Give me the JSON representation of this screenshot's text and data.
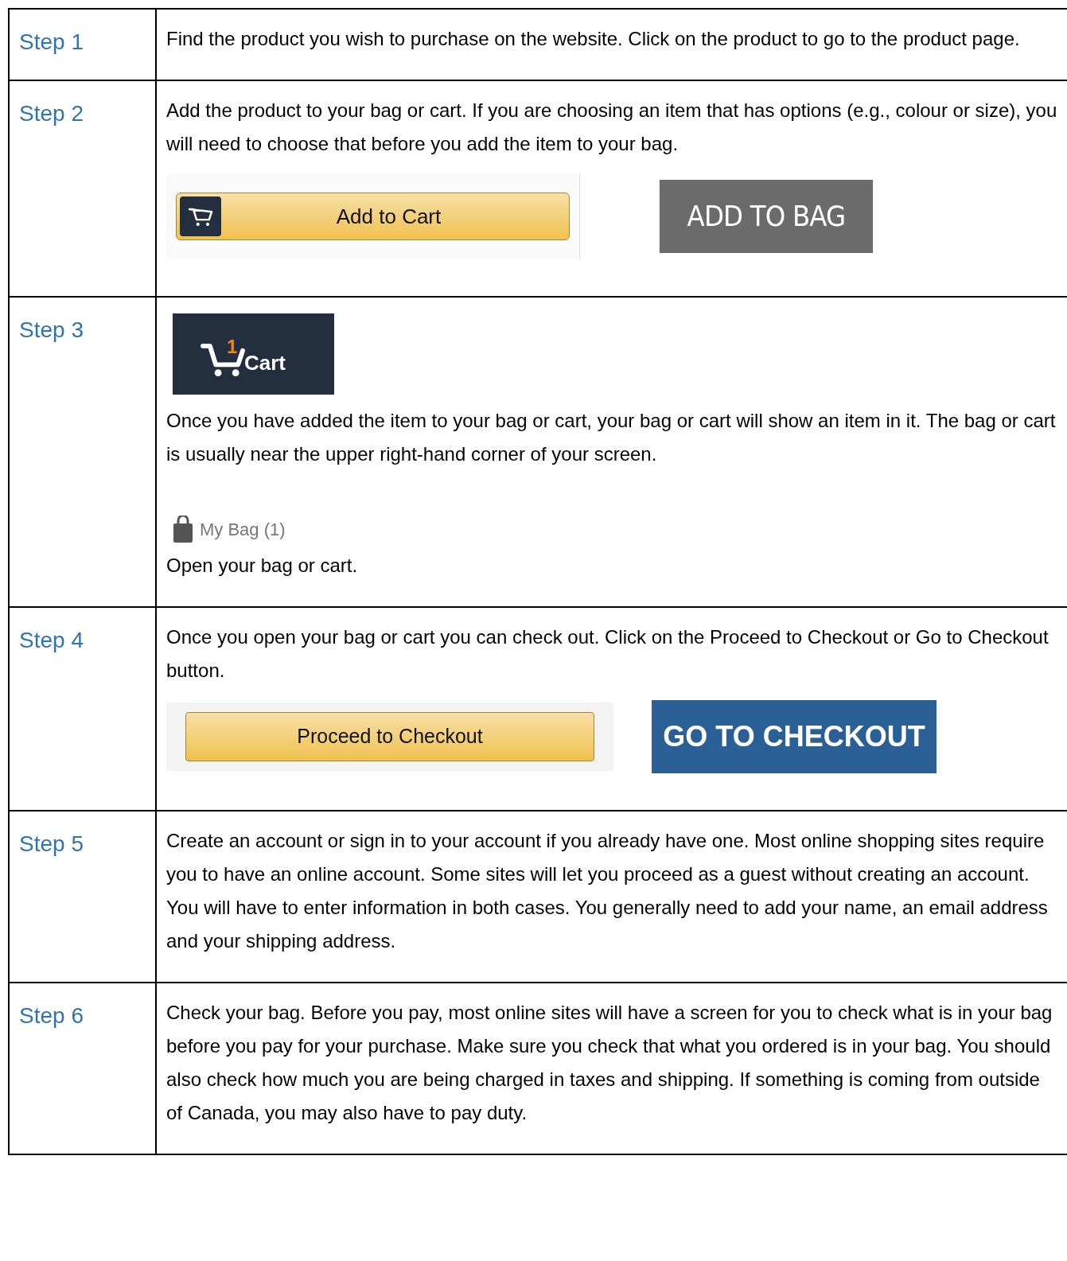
{
  "rows": [
    {
      "label": "Step 1",
      "blocks": [
        {
          "kind": "text",
          "text": "Find the product you wish to purchase on the website. Click on the product to go to the product page."
        }
      ]
    },
    {
      "label": "Step 2",
      "blocks": [
        {
          "kind": "text",
          "text": "Add the product to your bag or cart. If you are choosing an item that has options (e.g., colour or size), you will need to choose that before you add the item to your bag."
        },
        {
          "kind": "buttons",
          "items": [
            {
              "kind": "cart-yellow",
              "label": "Add to Cart"
            },
            {
              "kind": "grey",
              "label": "ADD TO BAG"
            }
          ]
        }
      ]
    },
    {
      "label": "Step 3",
      "blocks": [
        {
          "kind": "cart-badge",
          "count": "1",
          "label": "Cart"
        },
        {
          "kind": "text",
          "text": "Once you have added the item to your bag or cart, your bag or cart will show an item in it. The bag or cart is usually near the upper right-hand corner of your screen."
        },
        {
          "kind": "bag-link",
          "label": "My Bag",
          "count": "(1)"
        },
        {
          "kind": "text",
          "text": "Open your bag or cart."
        }
      ]
    },
    {
      "label": "Step 4",
      "blocks": [
        {
          "kind": "text",
          "text": "Once you open your bag or cart you can check out. Click on the Proceed to Checkout or Go to Checkout button."
        },
        {
          "kind": "buttons",
          "items": [
            {
              "kind": "yellow",
              "label": "Proceed to Checkout"
            },
            {
              "kind": "blue",
              "label": "GO TO CHECKOUT"
            }
          ]
        }
      ]
    },
    {
      "label": "Step 5",
      "blocks": [
        {
          "kind": "text",
          "text": "Create an account or sign in to your account if you already have one. Most online shopping sites require you to have an online account. Some sites will let you proceed as a guest without creating an account. You will have to enter information in both cases. You generally need to add your name, an email address and your shipping address."
        }
      ]
    },
    {
      "label": "Step 6",
      "blocks": [
        {
          "kind": "text",
          "text": "Check your bag. Before you pay, most online sites will have a screen for you to check what is in your bag before you pay for your purchase. Make sure you check that what you ordered is in your bag. You should also check how much you are being charged in taxes and shipping. If something is coming from outside of Canada, you may also have to pay duty."
        }
      ]
    }
  ]
}
